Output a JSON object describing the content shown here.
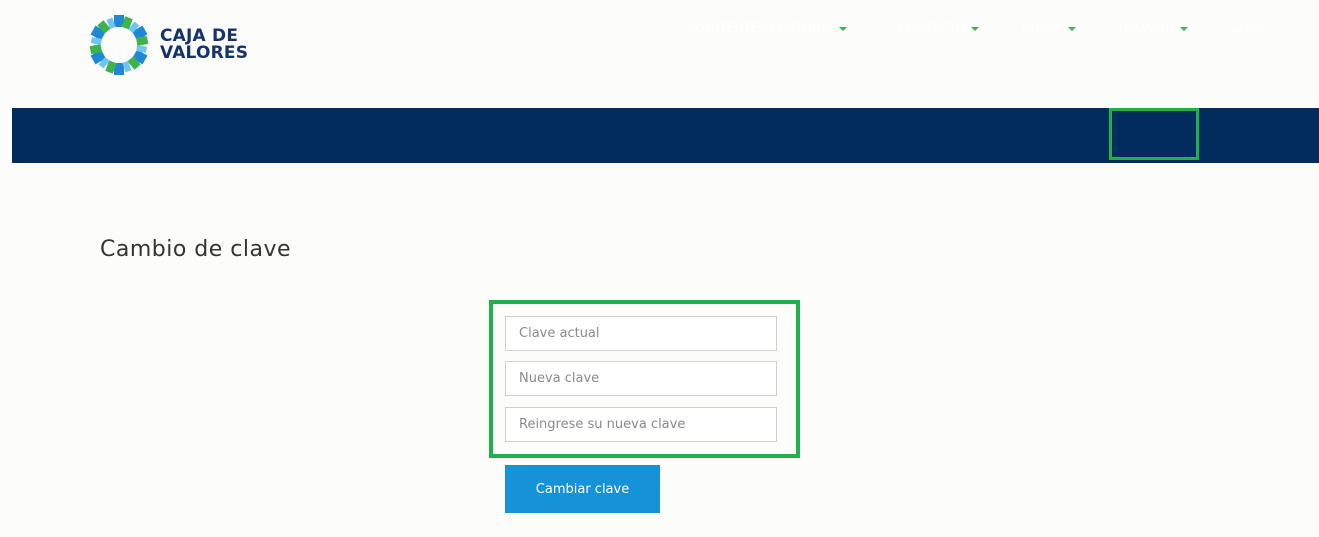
{
  "brand": {
    "line1": "CAJA DE",
    "line2": "VALORES"
  },
  "nav": {
    "items": [
      {
        "label": "COMITENTES CUSTODIA",
        "has_dropdown": true
      },
      {
        "label": "CONTACTO",
        "has_dropdown": true
      },
      {
        "label": "AYUDA",
        "has_dropdown": true
      },
      {
        "label": "USUARIO",
        "has_dropdown": true
      },
      {
        "label": "SALIR",
        "has_dropdown": false
      }
    ]
  },
  "page": {
    "title": "Cambio de clave"
  },
  "form": {
    "current_password": {
      "placeholder": "Clave actual",
      "value": ""
    },
    "new_password": {
      "placeholder": "Nueva clave",
      "value": ""
    },
    "confirm_password": {
      "placeholder": "Reingrese su nueva clave",
      "value": ""
    },
    "submit_label": "Cambiar clave"
  },
  "colors": {
    "navbar": "#022c5e",
    "accent_green": "#20b14a",
    "button_blue": "#1592d8",
    "brand_text": "#14336a"
  }
}
